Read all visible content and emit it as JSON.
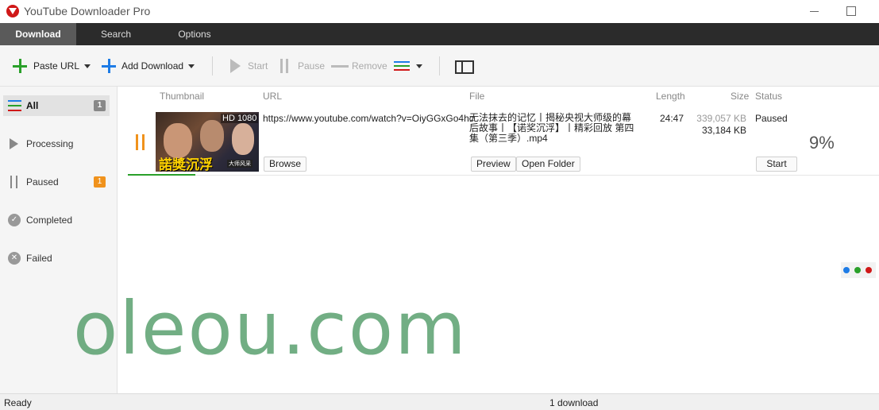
{
  "window": {
    "title": "YouTube Downloader Pro"
  },
  "tabs": [
    {
      "label": "Download",
      "active": true
    },
    {
      "label": "Search",
      "active": false
    },
    {
      "label": "Options",
      "active": false
    }
  ],
  "toolbar": {
    "paste_url": "Paste URL",
    "add_download": "Add Download",
    "start": "Start",
    "pause": "Pause",
    "remove": "Remove"
  },
  "sidebar": {
    "items": [
      {
        "label": "All",
        "badge": "1",
        "icon": "list-icon",
        "active": true
      },
      {
        "label": "Processing",
        "badge": "",
        "icon": "play-icon",
        "active": false
      },
      {
        "label": "Paused",
        "badge": "1",
        "icon": "pause-icon",
        "active": false
      },
      {
        "label": "Completed",
        "badge": "",
        "icon": "check-circle-icon",
        "active": false
      },
      {
        "label": "Failed",
        "badge": "",
        "icon": "x-circle-icon",
        "active": false
      }
    ]
  },
  "columns": {
    "thumbnail": "Thumbnail",
    "url": "URL",
    "file": "File",
    "length": "Length",
    "size": "Size",
    "status": "Status"
  },
  "downloads": [
    {
      "thumb_quality": "HD 1080",
      "thumb_caption": "諾獎沉浮",
      "thumb_sub": "大师风采",
      "url": "https://www.youtube.com/watch?v=OiyGGxGo4hc",
      "file": "无法抹去的记忆丨揭秘央视大师级的幕后故事丨【诺奖沉浮】丨精彩回放 第四集（第三季）.mp4",
      "length": "24:47",
      "size_total": "339,057 KB",
      "size_done": "33,184 KB",
      "status": "Paused",
      "percent": "9%",
      "progress": 0.09,
      "buttons": {
        "browse": "Browse",
        "preview": "Preview",
        "open_folder": "Open Folder",
        "start": "Start"
      }
    }
  ],
  "watermark": "oleou.com",
  "statusbar": {
    "ready": "Ready",
    "count": "1 download"
  },
  "colors": {
    "accent_green": "#2aa02a",
    "accent_blue": "#1e7ce6",
    "accent_orange": "#f0921c",
    "tab_bg": "#2b2b2b",
    "brand_red": "#d01818"
  }
}
